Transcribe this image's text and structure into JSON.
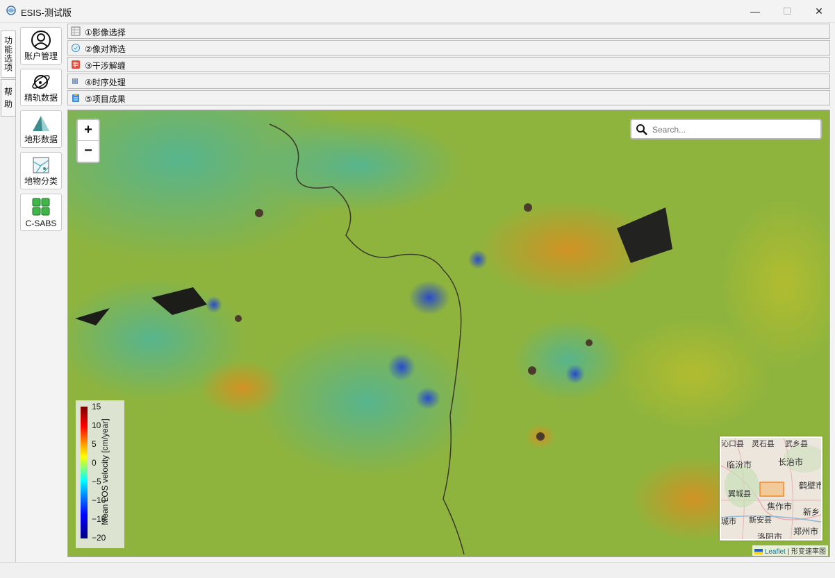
{
  "window": {
    "title": "ESIS-测试版",
    "minimize": "—",
    "maximize": "☐",
    "close": "✕"
  },
  "side_tabs": [
    {
      "label": "功能选项"
    },
    {
      "label": "帮 助"
    }
  ],
  "tools": [
    {
      "label": "账户管理",
      "icon": "account-icon"
    },
    {
      "label": "精轨数据",
      "icon": "satellite-orbit-icon"
    },
    {
      "label": "地形数据",
      "icon": "terrain-icon"
    },
    {
      "label": "地物分类",
      "icon": "landcover-icon"
    },
    {
      "label": "C-SABS",
      "icon": "grid-icon"
    }
  ],
  "panels": [
    {
      "label": "①影像选择"
    },
    {
      "label": "②像对筛选"
    },
    {
      "label": "③干涉解缠"
    },
    {
      "label": "④时序处理"
    },
    {
      "label": "⑤项目成果"
    }
  ],
  "map": {
    "zoom_in": "+",
    "zoom_out": "−",
    "search_placeholder": "Search...",
    "colorbar": {
      "label": "Mean LOS velocity [cm/year]",
      "ticks": [
        "15",
        "10",
        "5",
        "0",
        "−5",
        "−10",
        "−15",
        "−20"
      ]
    },
    "minimap": {
      "labels": [
        "沁口县",
        "灵石县",
        "武乡县",
        "临汾市",
        "长治市",
        "鹤壁市",
        "翼城县",
        "焦作市",
        "新乡",
        "城市",
        "新安县",
        "洛阳市",
        "郑州市"
      ]
    },
    "attribution": {
      "leaflet": "Leaflet",
      "rest": " | 形变速率图"
    }
  }
}
